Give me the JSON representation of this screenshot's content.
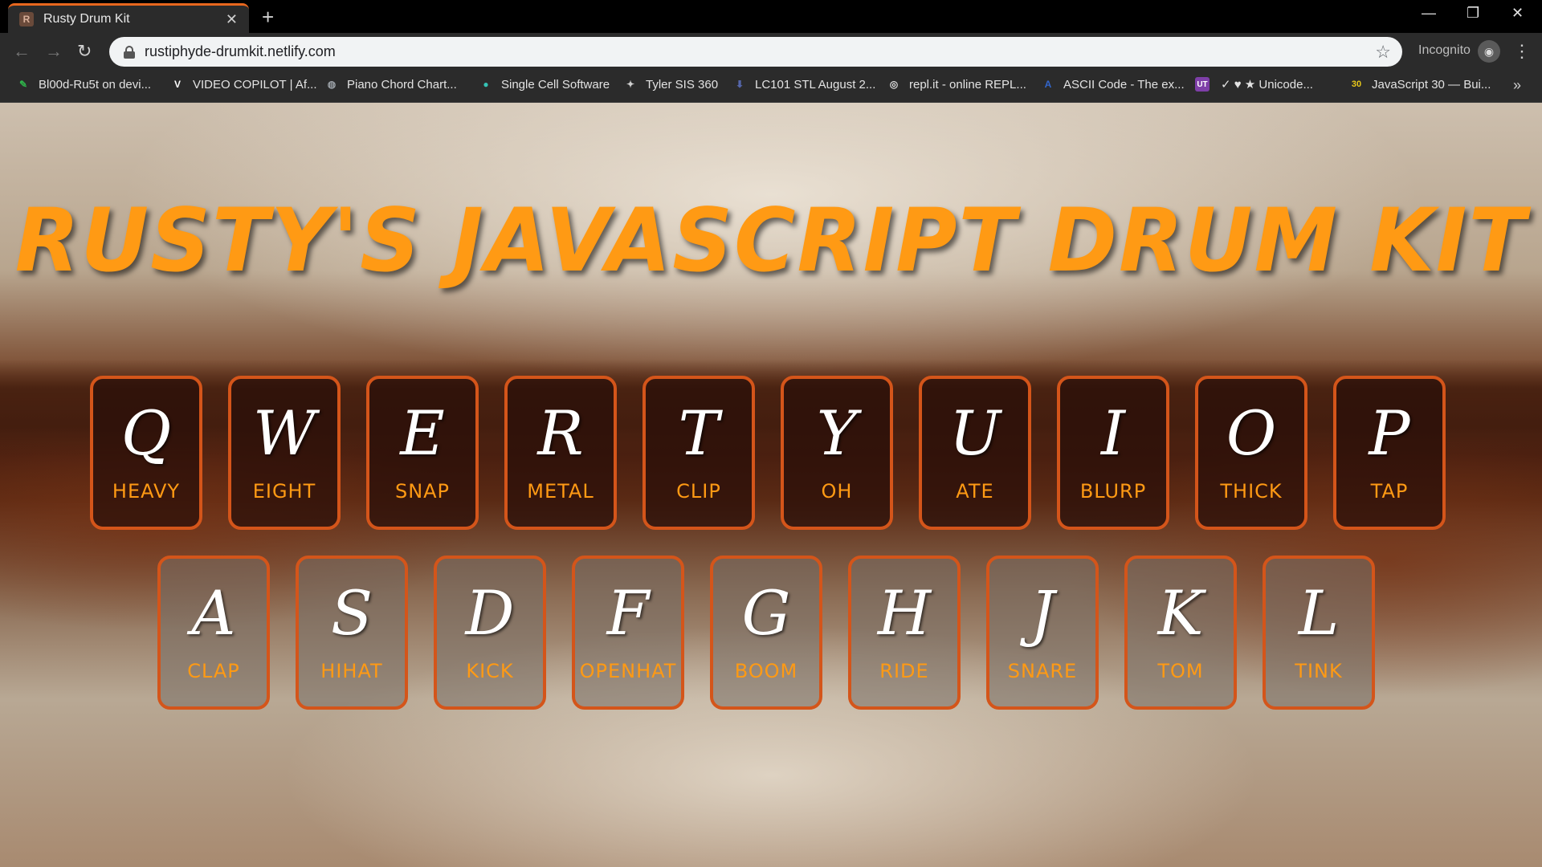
{
  "browser": {
    "tab_title": "Rusty Drum Kit",
    "tab_favicon": "R",
    "url": "rustiphyde-drumkit.netlify.com",
    "incognito_label": "Incognito"
  },
  "bookmarks": [
    {
      "label": "Bl00d-Ru5t on devi...",
      "icon": "dev-icon",
      "glyph": "",
      "color": "#2fb34a"
    },
    {
      "label": "VIDEO COPILOT | Af...",
      "icon": "videocopilot-icon",
      "glyph": "V",
      "color": "#ffffff"
    },
    {
      "label": "Piano Chord Chart...",
      "icon": "globe-icon",
      "glyph": "◍",
      "color": "#9aa0a6"
    },
    {
      "label": "Single Cell Software",
      "icon": "cell-icon",
      "glyph": "●",
      "color": "#35c3b5"
    },
    {
      "label": "Tyler SIS 360",
      "icon": "tyler-icon",
      "glyph": "✦",
      "color": "#cfcfcf"
    },
    {
      "label": "LC101 STL August 2...",
      "icon": "lc101-icon",
      "glyph": "⬇",
      "color": "#5566aa"
    },
    {
      "label": "repl.it - online REPL...",
      "icon": "replit-icon",
      "glyph": "◎",
      "color": "#dddddd"
    },
    {
      "label": "ASCII Code - The ex...",
      "icon": "ascii-icon",
      "glyph": "A",
      "color": "#3366cc"
    },
    {
      "label": "✓ ♥ ★ Unicode...",
      "icon": "unicode-icon",
      "glyph": "UT",
      "color": "#7e3fa8"
    },
    {
      "label": "JavaScript 30 — Bui...",
      "icon": "js30-icon",
      "glyph": "30",
      "color": "#e8c81a"
    }
  ],
  "page": {
    "title": "RUSTY'S JAVASCRIPT DRUM KIT",
    "row1": [
      {
        "key": "Q",
        "sound": "HEAVY"
      },
      {
        "key": "W",
        "sound": "EIGHT"
      },
      {
        "key": "E",
        "sound": "SNAP"
      },
      {
        "key": "R",
        "sound": "METAL"
      },
      {
        "key": "T",
        "sound": "CLIP"
      },
      {
        "key": "Y",
        "sound": "OH"
      },
      {
        "key": "U",
        "sound": "ATE"
      },
      {
        "key": "I",
        "sound": "BLURP"
      },
      {
        "key": "O",
        "sound": "THICK"
      },
      {
        "key": "P",
        "sound": "TAP"
      }
    ],
    "row2": [
      {
        "key": "A",
        "sound": "CLAP"
      },
      {
        "key": "S",
        "sound": "HIHAT"
      },
      {
        "key": "D",
        "sound": "KICK"
      },
      {
        "key": "F",
        "sound": "OPENHAT"
      },
      {
        "key": "G",
        "sound": "BOOM"
      },
      {
        "key": "H",
        "sound": "RIDE"
      },
      {
        "key": "J",
        "sound": "SNARE"
      },
      {
        "key": "K",
        "sound": "TOM"
      },
      {
        "key": "L",
        "sound": "TINK"
      }
    ]
  },
  "colors": {
    "accent": "#ff9a14",
    "key_border": "#d4551a",
    "tab_accent": "#e8671e"
  }
}
